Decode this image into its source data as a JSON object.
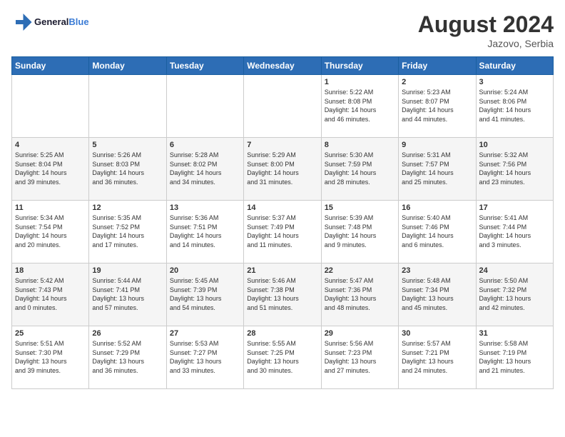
{
  "logo": {
    "text_general": "General",
    "text_blue": "Blue"
  },
  "header": {
    "month_year": "August 2024",
    "location": "Jazovo, Serbia"
  },
  "days_of_week": [
    "Sunday",
    "Monday",
    "Tuesday",
    "Wednesday",
    "Thursday",
    "Friday",
    "Saturday"
  ],
  "weeks": [
    [
      {
        "day": "",
        "info": ""
      },
      {
        "day": "",
        "info": ""
      },
      {
        "day": "",
        "info": ""
      },
      {
        "day": "",
        "info": ""
      },
      {
        "day": "1",
        "info": "Sunrise: 5:22 AM\nSunset: 8:08 PM\nDaylight: 14 hours\nand 46 minutes."
      },
      {
        "day": "2",
        "info": "Sunrise: 5:23 AM\nSunset: 8:07 PM\nDaylight: 14 hours\nand 44 minutes."
      },
      {
        "day": "3",
        "info": "Sunrise: 5:24 AM\nSunset: 8:06 PM\nDaylight: 14 hours\nand 41 minutes."
      }
    ],
    [
      {
        "day": "4",
        "info": "Sunrise: 5:25 AM\nSunset: 8:04 PM\nDaylight: 14 hours\nand 39 minutes."
      },
      {
        "day": "5",
        "info": "Sunrise: 5:26 AM\nSunset: 8:03 PM\nDaylight: 14 hours\nand 36 minutes."
      },
      {
        "day": "6",
        "info": "Sunrise: 5:28 AM\nSunset: 8:02 PM\nDaylight: 14 hours\nand 34 minutes."
      },
      {
        "day": "7",
        "info": "Sunrise: 5:29 AM\nSunset: 8:00 PM\nDaylight: 14 hours\nand 31 minutes."
      },
      {
        "day": "8",
        "info": "Sunrise: 5:30 AM\nSunset: 7:59 PM\nDaylight: 14 hours\nand 28 minutes."
      },
      {
        "day": "9",
        "info": "Sunrise: 5:31 AM\nSunset: 7:57 PM\nDaylight: 14 hours\nand 25 minutes."
      },
      {
        "day": "10",
        "info": "Sunrise: 5:32 AM\nSunset: 7:56 PM\nDaylight: 14 hours\nand 23 minutes."
      }
    ],
    [
      {
        "day": "11",
        "info": "Sunrise: 5:34 AM\nSunset: 7:54 PM\nDaylight: 14 hours\nand 20 minutes."
      },
      {
        "day": "12",
        "info": "Sunrise: 5:35 AM\nSunset: 7:52 PM\nDaylight: 14 hours\nand 17 minutes."
      },
      {
        "day": "13",
        "info": "Sunrise: 5:36 AM\nSunset: 7:51 PM\nDaylight: 14 hours\nand 14 minutes."
      },
      {
        "day": "14",
        "info": "Sunrise: 5:37 AM\nSunset: 7:49 PM\nDaylight: 14 hours\nand 11 minutes."
      },
      {
        "day": "15",
        "info": "Sunrise: 5:39 AM\nSunset: 7:48 PM\nDaylight: 14 hours\nand 9 minutes."
      },
      {
        "day": "16",
        "info": "Sunrise: 5:40 AM\nSunset: 7:46 PM\nDaylight: 14 hours\nand 6 minutes."
      },
      {
        "day": "17",
        "info": "Sunrise: 5:41 AM\nSunset: 7:44 PM\nDaylight: 14 hours\nand 3 minutes."
      }
    ],
    [
      {
        "day": "18",
        "info": "Sunrise: 5:42 AM\nSunset: 7:43 PM\nDaylight: 14 hours\nand 0 minutes."
      },
      {
        "day": "19",
        "info": "Sunrise: 5:44 AM\nSunset: 7:41 PM\nDaylight: 13 hours\nand 57 minutes."
      },
      {
        "day": "20",
        "info": "Sunrise: 5:45 AM\nSunset: 7:39 PM\nDaylight: 13 hours\nand 54 minutes."
      },
      {
        "day": "21",
        "info": "Sunrise: 5:46 AM\nSunset: 7:38 PM\nDaylight: 13 hours\nand 51 minutes."
      },
      {
        "day": "22",
        "info": "Sunrise: 5:47 AM\nSunset: 7:36 PM\nDaylight: 13 hours\nand 48 minutes."
      },
      {
        "day": "23",
        "info": "Sunrise: 5:48 AM\nSunset: 7:34 PM\nDaylight: 13 hours\nand 45 minutes."
      },
      {
        "day": "24",
        "info": "Sunrise: 5:50 AM\nSunset: 7:32 PM\nDaylight: 13 hours\nand 42 minutes."
      }
    ],
    [
      {
        "day": "25",
        "info": "Sunrise: 5:51 AM\nSunset: 7:30 PM\nDaylight: 13 hours\nand 39 minutes."
      },
      {
        "day": "26",
        "info": "Sunrise: 5:52 AM\nSunset: 7:29 PM\nDaylight: 13 hours\nand 36 minutes."
      },
      {
        "day": "27",
        "info": "Sunrise: 5:53 AM\nSunset: 7:27 PM\nDaylight: 13 hours\nand 33 minutes."
      },
      {
        "day": "28",
        "info": "Sunrise: 5:55 AM\nSunset: 7:25 PM\nDaylight: 13 hours\nand 30 minutes."
      },
      {
        "day": "29",
        "info": "Sunrise: 5:56 AM\nSunset: 7:23 PM\nDaylight: 13 hours\nand 27 minutes."
      },
      {
        "day": "30",
        "info": "Sunrise: 5:57 AM\nSunset: 7:21 PM\nDaylight: 13 hours\nand 24 minutes."
      },
      {
        "day": "31",
        "info": "Sunrise: 5:58 AM\nSunset: 7:19 PM\nDaylight: 13 hours\nand 21 minutes."
      }
    ]
  ]
}
